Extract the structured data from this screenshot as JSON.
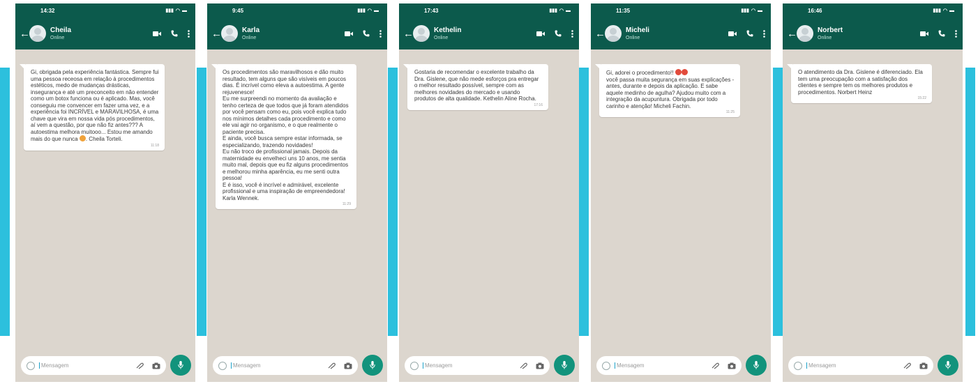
{
  "colors": {
    "header": "#0c5a4c",
    "accent_stripe": "#2cc0dd",
    "chat_bg": "#dcd6ce",
    "mic_button": "#12937c"
  },
  "placeholder": "Mensagem",
  "phones": [
    {
      "time": "14:32",
      "name": "Cheila",
      "status": "Online",
      "message": "Gi, obrigada pela experiência fantástica. Sempre fui uma pessoa receosa em relação à procedimentos estéticos, medo de mudanças drásticas, insegurança e até um preconceito em não entender como um botox funciona ou é aplicado. Mas, você conseguiu me convencer em fazer uma vez, e a experiência foi INCRÍVEL e MARAVILHOSA, é uma chave que vira em nossa vida pós procedimentos, aí vem a questão, por que não fiz antes??? A autoestima melhora muitooo... Estou me amando mais do que nunca",
      "message_end": ". Cheila Torteli.",
      "emoji": "smiling-face-with-hearts",
      "msg_time": "11:18"
    },
    {
      "time": "9:45",
      "name": "Karla",
      "status": "Online",
      "message": "Os procedimentos são maravilhosos e dão muito resultado, tem alguns que são visíveis em poucos dias. É incrível como eleva a autoestima. A gente rejuvenesce!\nEu me surpreendi no momento da avaliação e tenho certeza de que todos que já foram atendidos por você pensam como eu, pois você explica tudo nos mínimos detalhes cada procedimento e como ele vai agir no organismo, e o que realmente o paciente precisa.\nE ainda, você busca sempre estar informada, se especializando, trazendo novidades!\n Eu não troco de profissional jamais. Depois da maternidade eu envelheci uns 10 anos, me sentia muito mal, depois que eu fiz alguns procedimentos e melhorou minha aparência, eu me senti outra pessoa!\nE é isso, você é incrível e admirável, excelente profissional e uma inspiração de empreendedora! Karla Wennek.",
      "msg_time": "11:29"
    },
    {
      "time": "17:43",
      "name": "Kethelin",
      "status": "Online",
      "message": "Gostaria de recomendar o excelente trabalho da Dra. Gislene, que não mede esforços pra entregar o melhor resultado possível, sempre com as melhores novidades do mercado e usando produtos de alta qualidade. Kethelin Aline Rocha.",
      "msg_time": "17:16"
    },
    {
      "time": "11:35",
      "name": "Micheli",
      "status": "Online",
      "message_start": "Gi, adorei o procedimento!!",
      "message": "você passa muita segurança em suas explicações - antes, durante e depois da aplicação. E sabe aquele medinho de agulha? Ajudou muito com a integração da acupuntura. Obrigada por todo carinho e atenção! Micheli Fachin.",
      "emoji": "heart-eyes",
      "msg_time": "11:25"
    },
    {
      "time": "16:46",
      "name": "Norbert",
      "status": "Online",
      "message": "O atendimento da Dra. Gislene é diferenciado. Ela tem uma preocupação com a satisfação dos clientes e sempre tem os melhores produtos e procedimentos. Norbert Heinz",
      "msg_time": "15:22"
    }
  ]
}
